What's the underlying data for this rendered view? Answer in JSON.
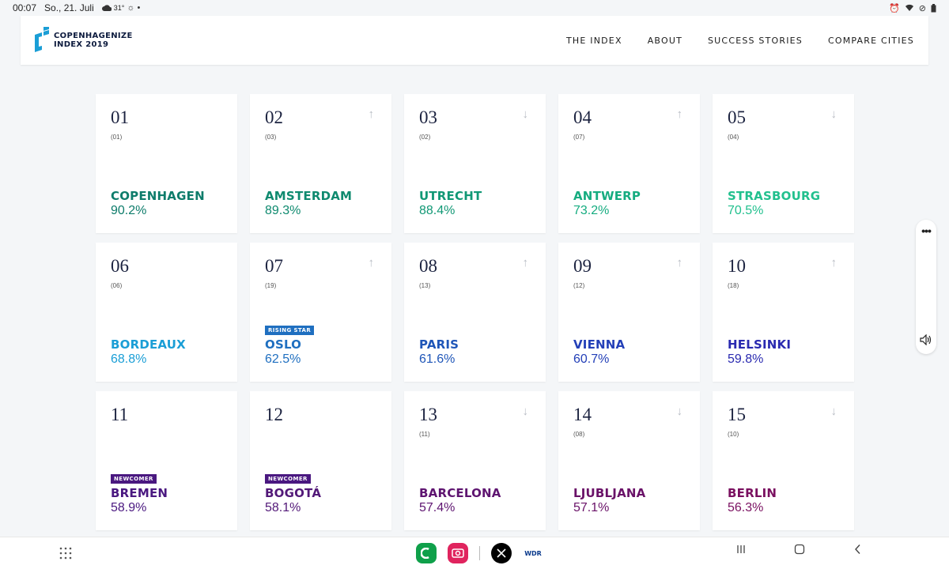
{
  "statusbar": {
    "time": "00:07",
    "date": "So., 21. Juli",
    "temperature": "31°",
    "weather_icon": "cloud-icon",
    "icons": [
      "alarm-icon",
      "wifi-icon",
      "no-sim-icon",
      "battery-icon"
    ]
  },
  "header": {
    "logo_line1": "COPENHAGENIZE",
    "logo_line2": "INDEX 2019",
    "nav": [
      "THE INDEX",
      "ABOUT",
      "SUCCESS STORIES",
      "COMPARE CITIES"
    ]
  },
  "colors": {
    "teal_dark": "#0e7c6b",
    "teal_light": "#1fbf8f",
    "cyan": "#1a9ed6",
    "blue": "#1f56b8",
    "indigo": "#2a2ab5",
    "purple": "#4a1880",
    "magenta": "#7a1060",
    "rising_star": "#1f6fc0",
    "newcomer": "#4a1880"
  },
  "cards": [
    {
      "rank": "01",
      "prev": "(01)",
      "arrow": "",
      "badge": "",
      "city": "COPENHAGEN",
      "score": "90.2%",
      "color": "#0e7c6b"
    },
    {
      "rank": "02",
      "prev": "(03)",
      "arrow": "↑",
      "badge": "",
      "city": "AMSTERDAM",
      "score": "89.3%",
      "color": "#0f8a6f"
    },
    {
      "rank": "03",
      "prev": "(02)",
      "arrow": "↓",
      "badge": "",
      "city": "UTRECHT",
      "score": "88.4%",
      "color": "#119875"
    },
    {
      "rank": "04",
      "prev": "(07)",
      "arrow": "↑",
      "badge": "",
      "city": "ANTWERP",
      "score": "73.2%",
      "color": "#16ac80"
    },
    {
      "rank": "05",
      "prev": "(04)",
      "arrow": "↓",
      "badge": "",
      "city": "STRASBOURG",
      "score": "70.5%",
      "color": "#22c08e"
    },
    {
      "rank": "06",
      "prev": "(06)",
      "arrow": "",
      "badge": "",
      "city": "BORDEAUX",
      "score": "68.8%",
      "color": "#1a9ed6"
    },
    {
      "rank": "07",
      "prev": "(19)",
      "arrow": "↑",
      "badge": "RISING STAR",
      "badge_color": "#1f6fc0",
      "city": "OSLO",
      "score": "62.5%",
      "color": "#1f6fc0"
    },
    {
      "rank": "08",
      "prev": "(13)",
      "arrow": "↑",
      "badge": "",
      "city": "PARIS",
      "score": "61.6%",
      "color": "#1f56b8"
    },
    {
      "rank": "09",
      "prev": "(12)",
      "arrow": "↑",
      "badge": "",
      "city": "VIENNA",
      "score": "60.7%",
      "color": "#2440b8"
    },
    {
      "rank": "10",
      "prev": "(18)",
      "arrow": "↑",
      "badge": "",
      "city": "HELSINKI",
      "score": "59.8%",
      "color": "#2a2ab0"
    },
    {
      "rank": "11",
      "prev": "",
      "arrow": "",
      "badge": "NEWCOMER",
      "badge_color": "#4a1880",
      "city": "BREMEN",
      "score": "58.9%",
      "color": "#4a1880"
    },
    {
      "rank": "12",
      "prev": "",
      "arrow": "",
      "badge": "NEWCOMER",
      "badge_color": "#4a1880",
      "city": "BOGOTÁ",
      "score": "58.1%",
      "color": "#521878"
    },
    {
      "rank": "13",
      "prev": "(11)",
      "arrow": "↓",
      "badge": "",
      "city": "BARCELONA",
      "score": "57.4%",
      "color": "#5e1470"
    },
    {
      "rank": "14",
      "prev": "(08)",
      "arrow": "↓",
      "badge": "",
      "city": "LJUBLJANA",
      "score": "57.1%",
      "color": "#6a1268"
    },
    {
      "rank": "15",
      "prev": "(10)",
      "arrow": "↓",
      "badge": "",
      "city": "BERLIN",
      "score": "56.3%",
      "color": "#7a1060"
    }
  ],
  "side_widget": {
    "icons": [
      "more-icon",
      "volume-icon"
    ]
  },
  "navbar": {
    "apps_icon": "apps-grid-icon",
    "dock": [
      "phone-app-icon",
      "camera-app-icon",
      "x-app-icon",
      "wdr-app-icon"
    ],
    "wdr_label": "WDR",
    "system": [
      "recents-icon",
      "home-icon",
      "back-icon"
    ]
  }
}
